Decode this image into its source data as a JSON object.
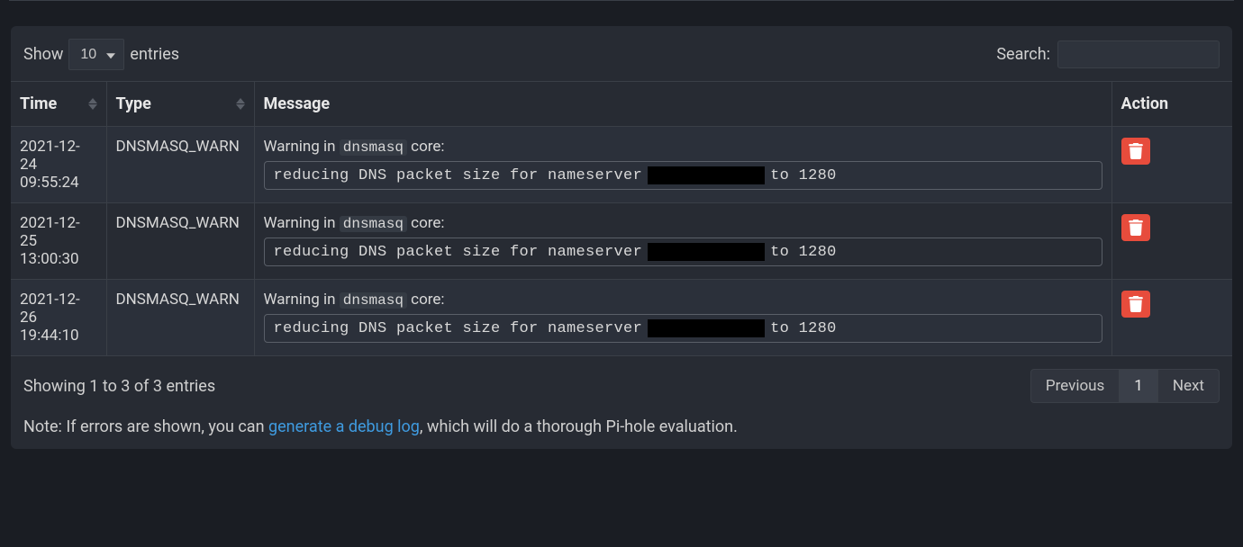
{
  "controls": {
    "show_label": "Show",
    "entries_label": "entries",
    "page_size": "10",
    "search_label": "Search:"
  },
  "columns": {
    "time": "Time",
    "type": "Type",
    "message": "Message",
    "action": "Action"
  },
  "rows": [
    {
      "time": "2021-12-24 09:55:24",
      "type": "DNSMASQ_WARN",
      "msg_prefix_a": "Warning in ",
      "msg_hl": "dnsmasq",
      "msg_prefix_b": " core:",
      "code_a": "reducing DNS packet size for nameserver",
      "code_b": "to 1280"
    },
    {
      "time": "2021-12-25 13:00:30",
      "type": "DNSMASQ_WARN",
      "msg_prefix_a": "Warning in ",
      "msg_hl": "dnsmasq",
      "msg_prefix_b": " core:",
      "code_a": "reducing DNS packet size for nameserver",
      "code_b": "to 1280"
    },
    {
      "time": "2021-12-26 19:44:10",
      "type": "DNSMASQ_WARN",
      "msg_prefix_a": "Warning in ",
      "msg_hl": "dnsmasq",
      "msg_prefix_b": " core:",
      "code_a": "reducing DNS packet size for nameserver",
      "code_b": "to 1280"
    }
  ],
  "footer": {
    "info": "Showing 1 to 3 of 3 entries",
    "previous": "Previous",
    "page": "1",
    "next": "Next"
  },
  "note": {
    "prefix": "Note: If errors are shown, you can ",
    "link": "generate a debug log",
    "suffix": ", which will do a thorough Pi-hole evaluation."
  }
}
